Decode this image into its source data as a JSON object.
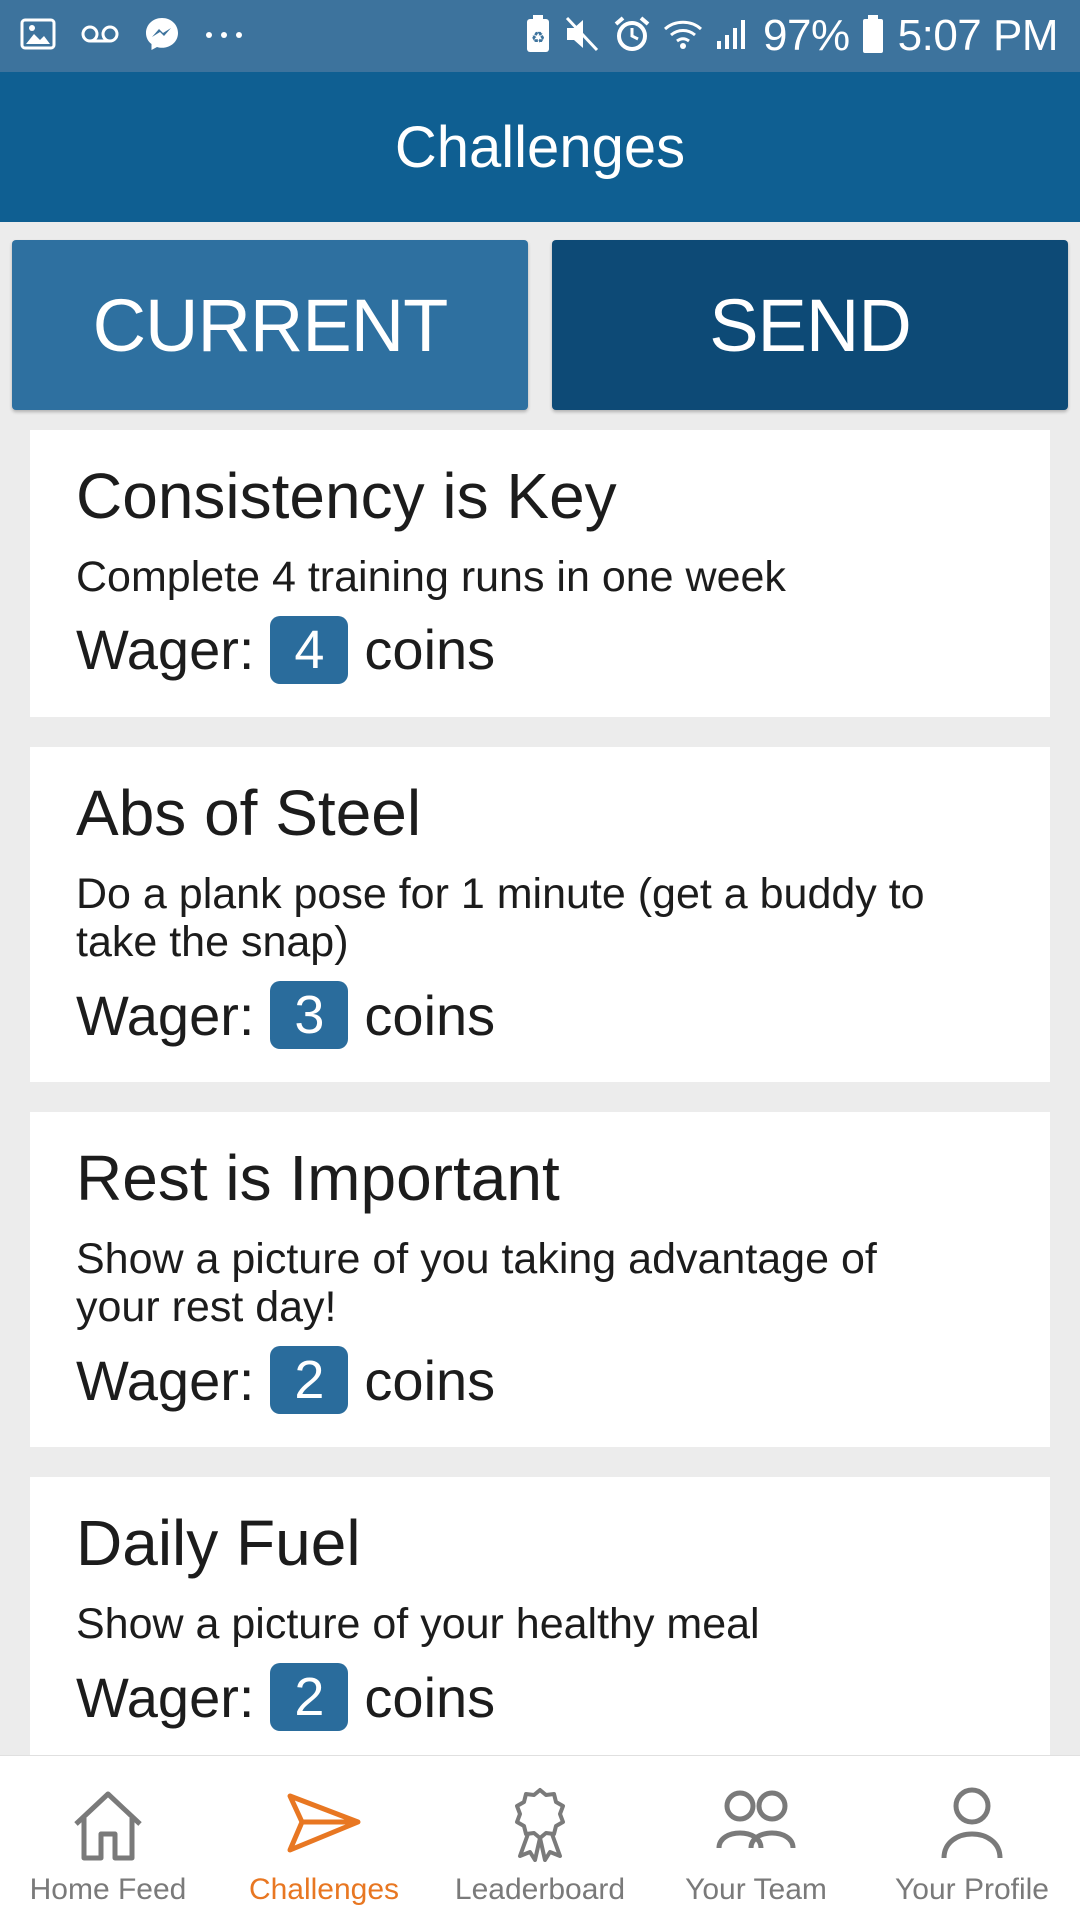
{
  "status_bar": {
    "left_icons": [
      "gallery-icon",
      "voicemail-icon",
      "messenger-icon",
      "more-dots-icon"
    ],
    "right_icons": [
      "battery-saver-icon",
      "mute-icon",
      "alarm-icon",
      "wifi-icon",
      "signal-icon"
    ],
    "battery": "97%",
    "time": "5:07 PM"
  },
  "header": {
    "title": "Challenges"
  },
  "tabs": [
    {
      "label": "CURRENT",
      "selected": true
    },
    {
      "label": "SEND",
      "selected": false
    }
  ],
  "challenges": [
    {
      "title": "Consistency is Key",
      "description": "Complete 4 training runs in one week",
      "wager_label": "Wager:",
      "wager": "4",
      "unit": "coins"
    },
    {
      "title": "Abs of Steel",
      "description": "Do a plank pose for 1 minute (get a buddy to take the snap)",
      "wager_label": "Wager:",
      "wager": "3",
      "unit": "coins"
    },
    {
      "title": "Rest is Important",
      "description": "Show a picture of you taking advantage of your rest day!",
      "wager_label": "Wager:",
      "wager": "2",
      "unit": "coins"
    },
    {
      "title": "Daily Fuel",
      "description": "Show a picture of your healthy meal",
      "wager_label": "Wager:",
      "wager": "2",
      "unit": "coins"
    }
  ],
  "nav": {
    "items": [
      {
        "label": "Home Feed",
        "icon": "home-icon"
      },
      {
        "label": "Challenges",
        "icon": "send-arrow-icon",
        "active": true
      },
      {
        "label": "Leaderboard",
        "icon": "award-ribbon-icon"
      },
      {
        "label": "Your Team",
        "icon": "team-icon"
      },
      {
        "label": "Your Profile",
        "icon": "profile-icon"
      }
    ]
  },
  "colors": {
    "status_bar": "#3d739d",
    "header": "#0f5f92",
    "tab_current": "#2e70a0",
    "tab_send": "#0d4a76",
    "badge": "#2a6c9c",
    "nav_active": "#e87722",
    "nav_inactive": "#7a7a7a"
  }
}
